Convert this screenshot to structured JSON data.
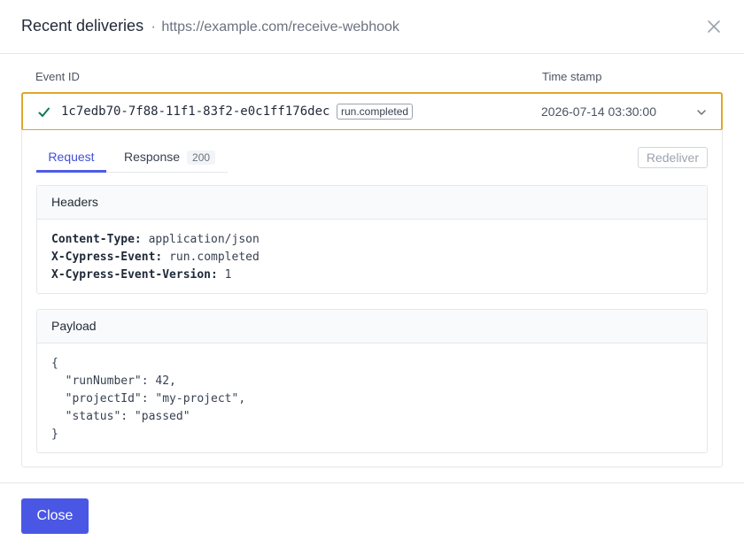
{
  "header": {
    "title": "Recent deliveries",
    "separator": "·",
    "url": "https://example.com/receive-webhook"
  },
  "columns": {
    "event_id": "Event ID",
    "timestamp": "Time stamp"
  },
  "delivery": {
    "event_id": "1c7edb70-7f88-11f1-83f2-e0c1ff176dec",
    "event_type": "run.completed",
    "timestamp": "2026-07-14 03:30:00",
    "status_icon": "check-icon",
    "status_color": "#0f7a5a",
    "row_border_color": "#e0a62a"
  },
  "tabs": {
    "request": "Request",
    "response": "Response",
    "response_code": "200"
  },
  "redeliver_label": "Redeliver",
  "headers_section": {
    "title": "Headers",
    "items": [
      {
        "key": "Content-Type:",
        "value": "application/json"
      },
      {
        "key": "X-Cypress-Event:",
        "value": "run.completed"
      },
      {
        "key": "X-Cypress-Event-Version:",
        "value": "1"
      }
    ]
  },
  "payload_section": {
    "title": "Payload",
    "lines": [
      "{",
      "  \"runNumber\": 42,",
      "  \"projectId\": \"my-project\",",
      "  \"status\": \"passed\"",
      "}"
    ]
  },
  "footer": {
    "close_label": "Close"
  },
  "colors": {
    "accent": "#4a57e4"
  }
}
